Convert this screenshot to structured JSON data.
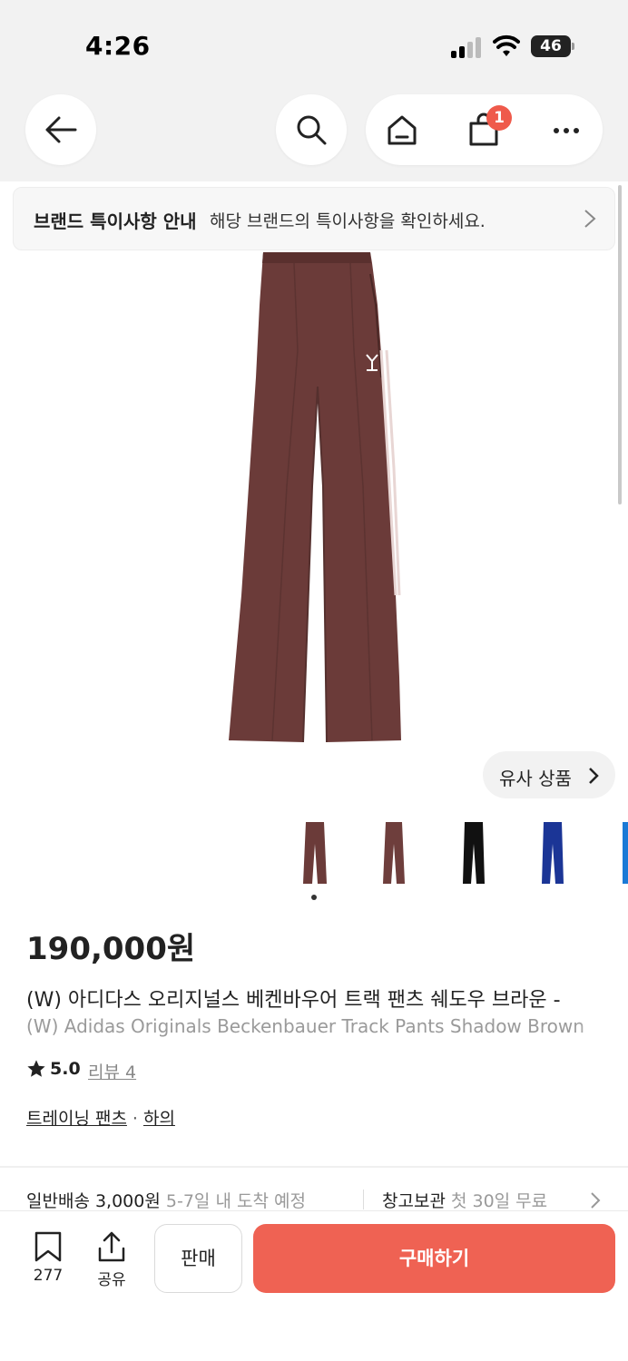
{
  "status": {
    "time": "4:26",
    "battery": "46"
  },
  "header": {
    "cart_count": "1"
  },
  "notice": {
    "title": "브랜드 특이사항 안내",
    "description": "해당 브랜드의 특이사항을 확인하세요."
  },
  "similar": {
    "label": "유사 상품"
  },
  "product": {
    "price": "190,000원",
    "name_ko": "(W) 아디다스 오리지널스 베켄바우어 트랙 팬츠 쉐도우 브라운 - ",
    "name_en": "(W) Adidas Originals Beckenbauer Track Pants Shadow Brown",
    "rating": "5.0",
    "review_label": "리뷰 4",
    "category_1": "트레이닝 팬츠",
    "category_sep": "·",
    "category_2": "하의",
    "thumbnail_colors": [
      "#6b3b39",
      "#6e3e3c",
      "#111111",
      "#1b3596",
      "#1b7ad6"
    ]
  },
  "shipping": {
    "label": "일반배송 3,000원",
    "eta": "5-7일 내 도착 예정",
    "storage_label": "창고보관",
    "storage_note": "첫 30일 무료"
  },
  "bottom": {
    "bookmark_count": "277",
    "share_label": "공유",
    "sell_label": "판매",
    "buy_label": "구매하기"
  },
  "colors": {
    "accent": "#ef6253",
    "badge": "#ef5a4b",
    "pants": "#6b3b39"
  }
}
